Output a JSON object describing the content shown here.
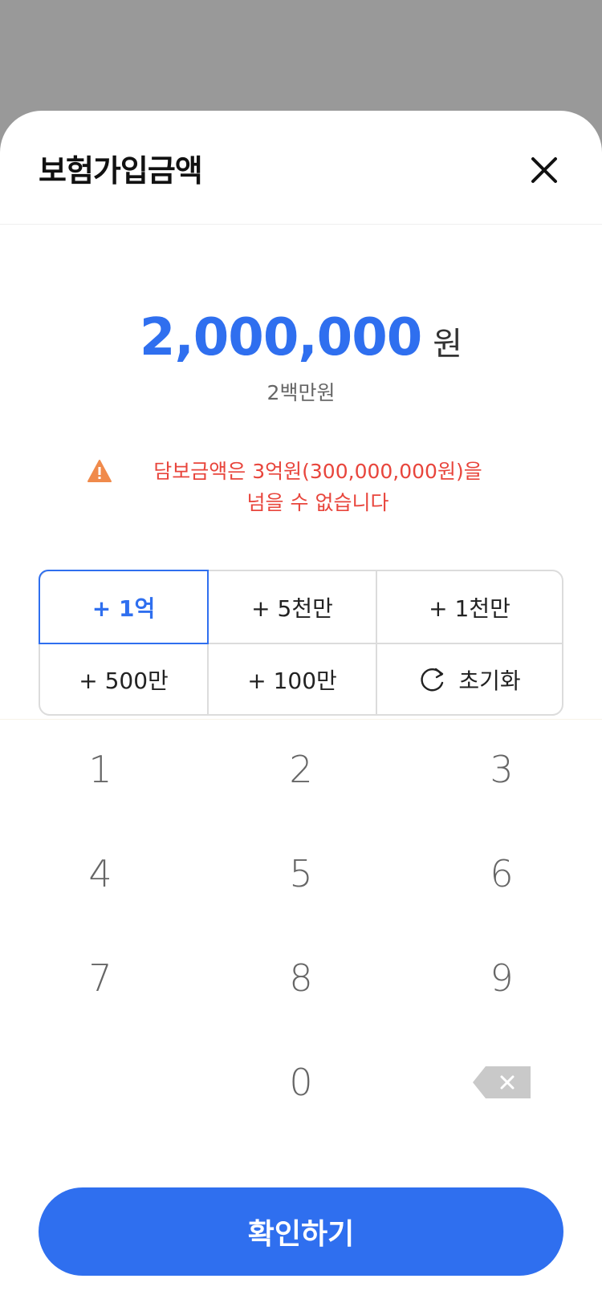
{
  "sheet": {
    "title": "보험가입금액"
  },
  "amount": {
    "value": "2,000,000",
    "unit": "원",
    "korean": "2백만원"
  },
  "warning": {
    "line1": "담보금액은 3억원(300,000,000원)을",
    "line2": "넘을 수 없습니다",
    "icon": "warning-triangle-icon"
  },
  "quick_buttons": [
    {
      "label": "+ 1억",
      "selected": true
    },
    {
      "label": "+ 5천만",
      "selected": false
    },
    {
      "label": "+ 1천만",
      "selected": false
    },
    {
      "label": "+ 500만",
      "selected": false
    },
    {
      "label": "+ 100만",
      "selected": false
    },
    {
      "label": "초기화",
      "icon": "refresh-icon",
      "selected": false
    }
  ],
  "keypad": [
    "1",
    "2",
    "3",
    "4",
    "5",
    "6",
    "7",
    "8",
    "9",
    "",
    "0",
    "backspace"
  ],
  "confirm": {
    "label": "확인하기"
  },
  "colors": {
    "accent": "#2f6fef",
    "warning_text": "#e8453c",
    "warning_icon": "#f08a4b",
    "overlay": "#999999"
  }
}
